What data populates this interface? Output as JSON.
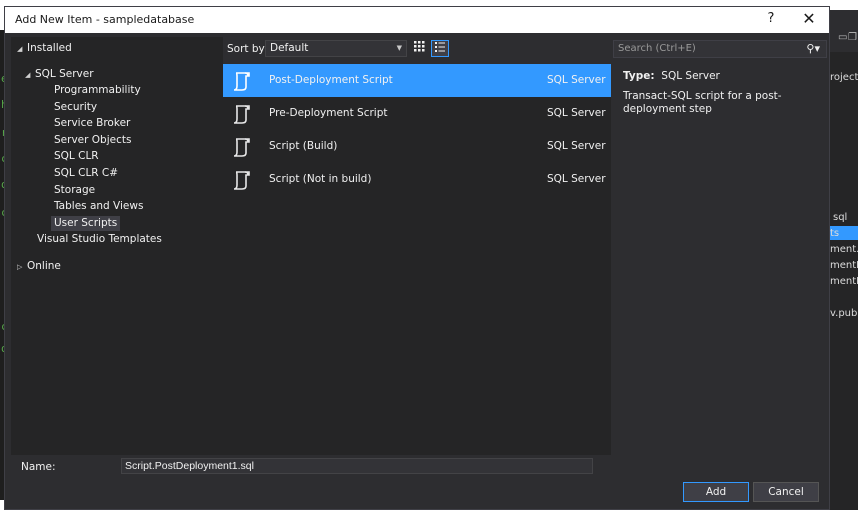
{
  "dialog": {
    "title": "Add New Item - sampledatabase",
    "help_label": "?",
    "close_label": "✕"
  },
  "tree": {
    "installed": "Installed",
    "sql_server": "SQL Server",
    "children": [
      "Programmability",
      "Security",
      "Service Broker",
      "Server Objects",
      "SQL CLR",
      "SQL CLR C#",
      "Storage",
      "Tables and Views",
      "User Scripts"
    ],
    "vs_templates": "Visual Studio Templates",
    "online": "Online"
  },
  "toolbar": {
    "sort_label": "Sort by:",
    "sort_value": "Default",
    "search_placeholder": "Search (Ctrl+E)"
  },
  "templates": [
    {
      "name": "Post-Deployment Script",
      "type": "SQL Server",
      "selected": true
    },
    {
      "name": "Pre-Deployment Script",
      "type": "SQL Server",
      "selected": false
    },
    {
      "name": "Script (Build)",
      "type": "SQL Server",
      "selected": false
    },
    {
      "name": "Script (Not in build)",
      "type": "SQL Server",
      "selected": false
    }
  ],
  "details": {
    "type_label": "Type:",
    "type_value": "SQL Server",
    "description": "Transact-SQL script for a post-deployment step"
  },
  "footer": {
    "name_label": "Name:",
    "name_value": "Script.PostDeployment1.sql",
    "add_label": "Add",
    "cancel_label": "Cancel"
  },
  "background": {
    "right_fragments": [
      "roject",
      "sql",
      "ts",
      "ment.",
      "mentD",
      "mentE",
      "v.pub"
    ],
    "code_fragments": [
      "e",
      "h",
      "r",
      "c",
      "o",
      "c",
      "c",
      "o",
      "o"
    ]
  },
  "colors": {
    "accent": "#3399ff",
    "dialog_bg": "#2d2d30",
    "panel_bg": "#252526"
  }
}
